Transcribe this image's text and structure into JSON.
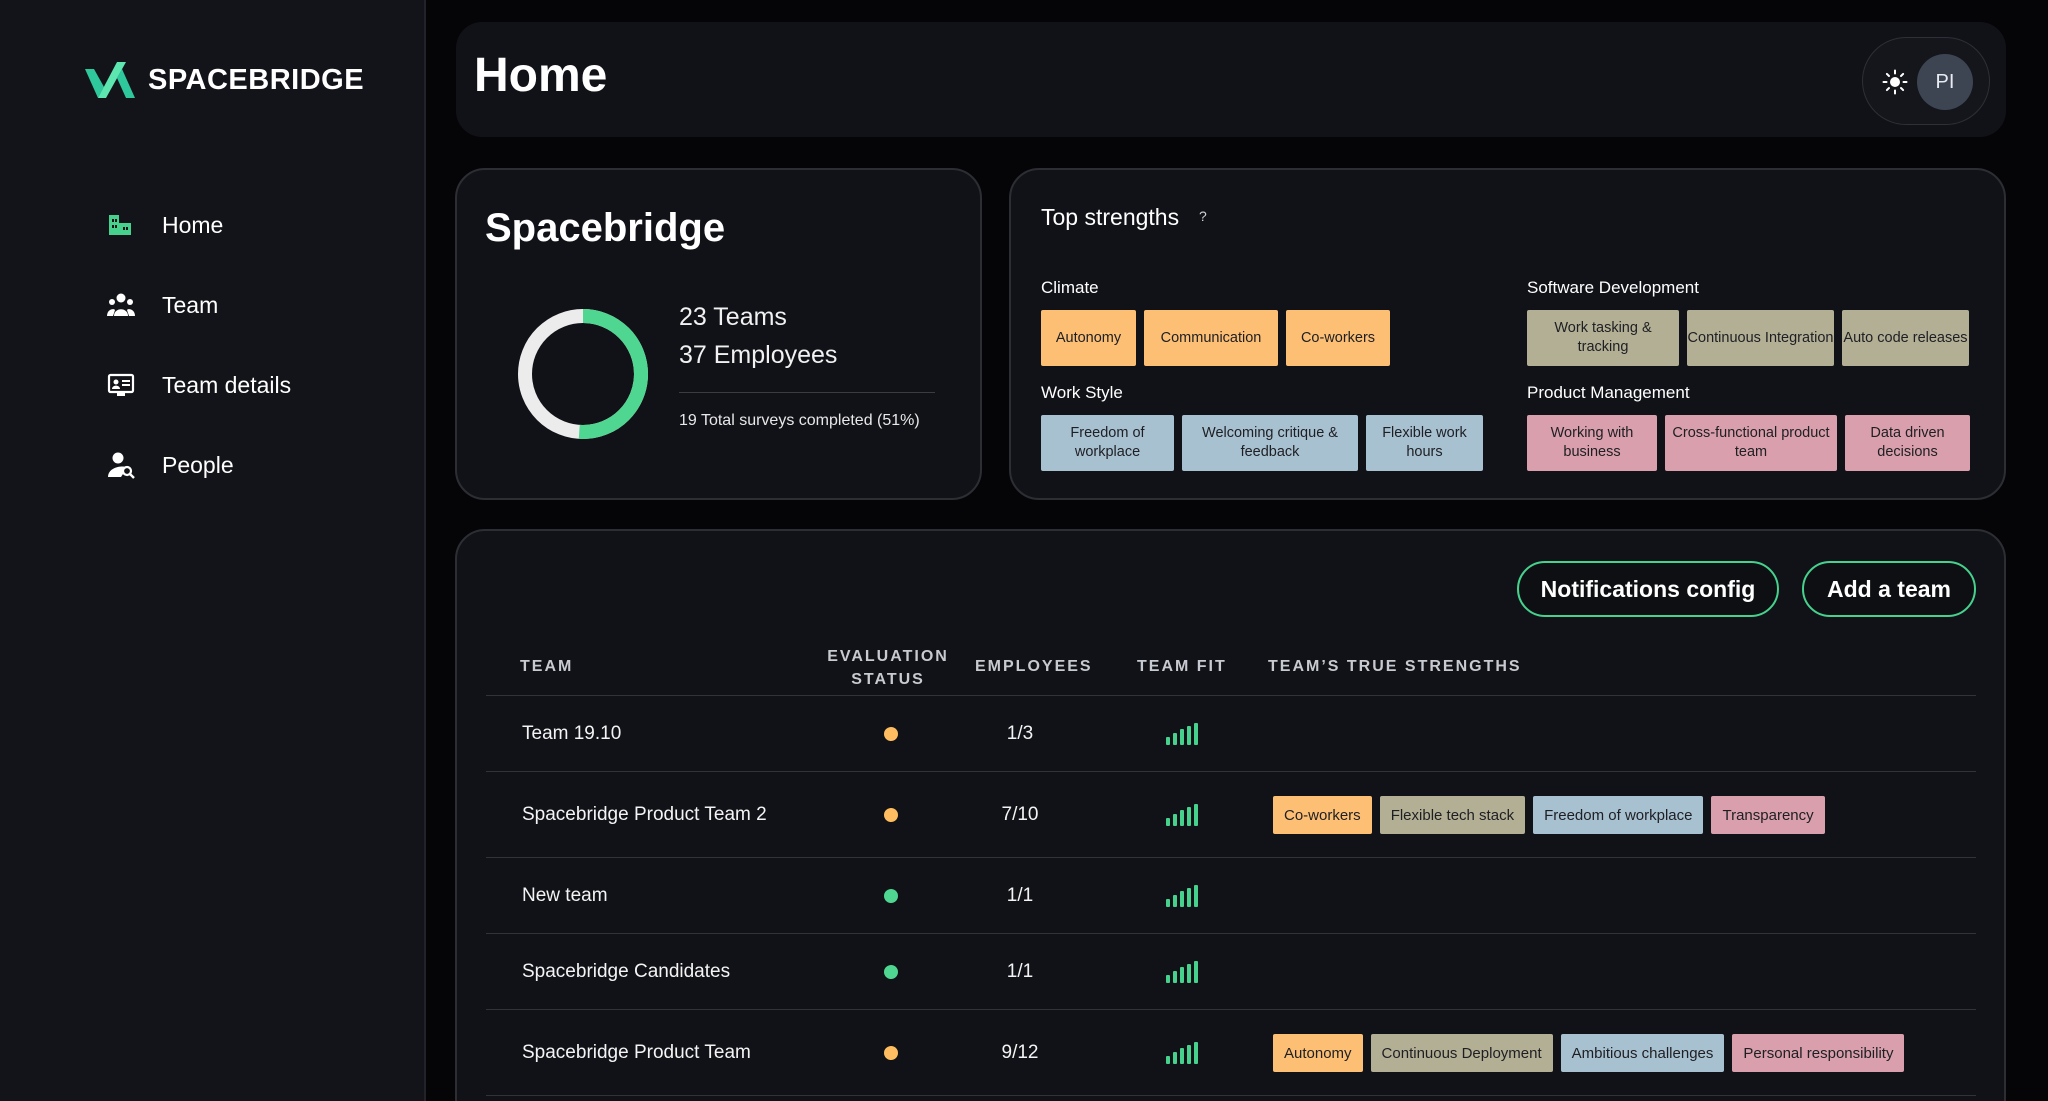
{
  "app": {
    "name": "SPACEBRIDGE"
  },
  "nav": [
    {
      "label": "Home",
      "icon": "building-icon"
    },
    {
      "label": "Team",
      "icon": "team-icon"
    },
    {
      "label": "Team details",
      "icon": "team-details-icon"
    },
    {
      "label": "People",
      "icon": "people-search-icon"
    }
  ],
  "header": {
    "title": "Home",
    "avatar_initials": "PI",
    "theme_icon": "sun-icon"
  },
  "summary": {
    "title": "Spacebridge",
    "teams": "23 Teams",
    "employees": "37 Employees",
    "surveys": "19 Total surveys completed (51%)",
    "completion_fraction": 0.51
  },
  "strengths": {
    "title": "Top strengths",
    "help": "?",
    "categories": [
      {
        "name": "Climate",
        "items": [
          "Autonomy",
          "Communication",
          "Co-workers"
        ]
      },
      {
        "name": "Software Development",
        "items": [
          "Work tasking & tracking",
          "Continuous Integration",
          "Auto code releases"
        ]
      },
      {
        "name": "Work Style",
        "items": [
          "Freedom of workplace",
          "Welcoming critique & feedback",
          "Flexible work hours"
        ]
      },
      {
        "name": "Product Management",
        "items": [
          "Working with business",
          "Cross-functional product team",
          "Data driven decisions"
        ]
      }
    ]
  },
  "actions": {
    "notifications": "Notifications config",
    "add_team": "Add a team"
  },
  "table": {
    "headers": {
      "team": "TEAM",
      "status_line1": "EVALUATION",
      "status_line2": "STATUS",
      "employees": "EMPLOYEES",
      "fit": "TEAM FIT",
      "strengths": "TEAM’S TRUE STRENGTHS"
    },
    "rows": [
      {
        "team": "Team 19.10",
        "status": "orange",
        "employees": "1/3",
        "strengths": []
      },
      {
        "team": "Spacebridge Product Team 2",
        "status": "orange",
        "employees": "7/10",
        "strengths": [
          "Co-workers",
          "Flexible tech stack",
          "Freedom of workplace",
          "Transparency"
        ]
      },
      {
        "team": "New team",
        "status": "green",
        "employees": "1/1",
        "strengths": []
      },
      {
        "team": "Spacebridge Candidates",
        "status": "green",
        "employees": "1/1",
        "strengths": []
      },
      {
        "team": "Spacebridge Product Team",
        "status": "orange",
        "employees": "9/12",
        "strengths": [
          "Autonomy",
          "Continuous Deployment",
          "Ambitious challenges",
          "Personal responsibility"
        ]
      }
    ]
  },
  "colors": {
    "accent": "#46d18d",
    "climate": "#fdbf74",
    "work_style": "#a8c1d1",
    "software": "#b3af95",
    "product": "#d99fac"
  }
}
